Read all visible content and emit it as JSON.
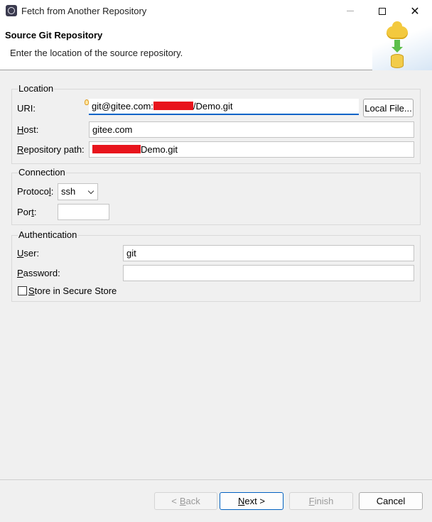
{
  "window": {
    "title": "Fetch from Another Repository"
  },
  "banner": {
    "title": "Source Git Repository",
    "message": "Enter the location of the source repository."
  },
  "location": {
    "legend": "Location",
    "uri_label": "URI:",
    "uri_value_start": "git@gitee.com:",
    "uri_value_end": "/Demo.git",
    "local_file_button": "Local File...",
    "host_label": "Host:",
    "host_value": "gitee.com",
    "repo_path_label": "Repository path:",
    "repo_path_value_end": "Demo.git"
  },
  "connection": {
    "legend": "Connection",
    "protocol_label": "Protocol:",
    "protocol_value": "ssh",
    "port_label": "Port:",
    "port_value": ""
  },
  "authentication": {
    "legend": "Authentication",
    "user_label": "User:",
    "user_value": "git",
    "password_label": "Password:",
    "password_value": "",
    "secure_store_label": "Store in Secure Store",
    "secure_store_checked": false
  },
  "buttons": {
    "back": "< Back",
    "next": "Next >",
    "finish": "Finish",
    "cancel": "Cancel"
  },
  "colors": {
    "focus_accent": "#0064c8",
    "redaction": "#e8141c"
  }
}
